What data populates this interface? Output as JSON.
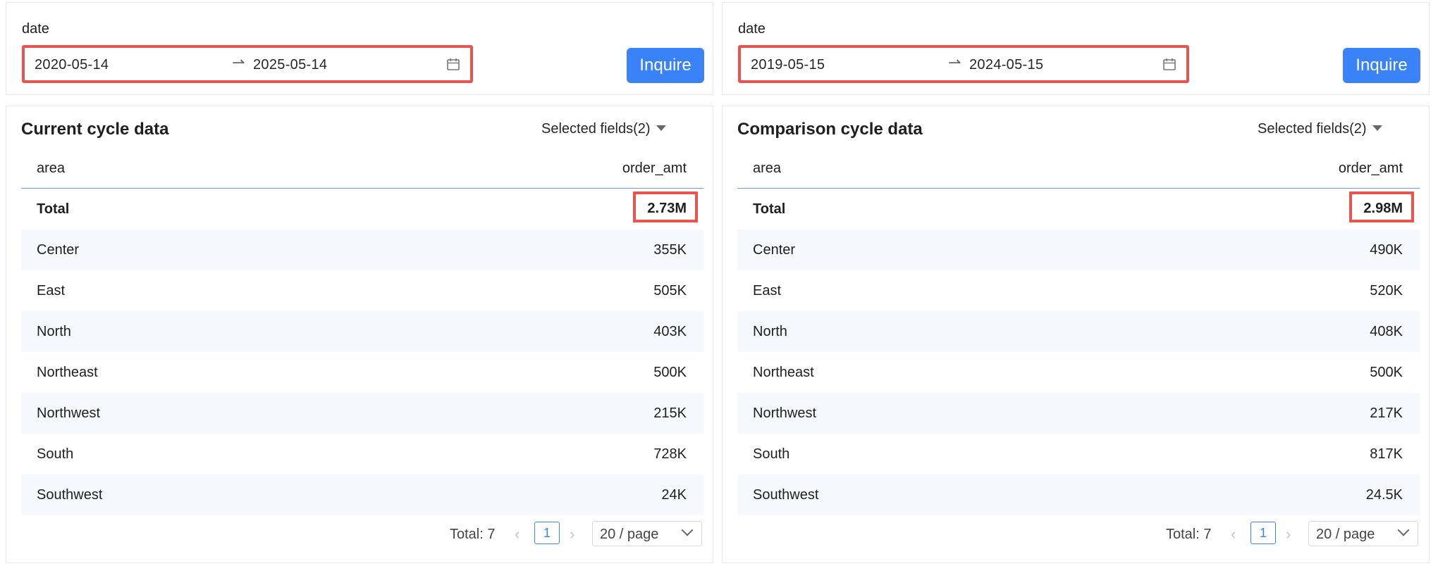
{
  "left": {
    "filter": {
      "label": "date",
      "start": "2020-05-14",
      "end": "2025-05-14",
      "arrow": "⇀"
    },
    "inquire_label": "Inquire",
    "title": "Current cycle data",
    "fields_label": "Selected fields(2)",
    "columns": {
      "area": "area",
      "amt": "order_amt"
    },
    "total": {
      "label": "Total",
      "value": "2.73M"
    },
    "rows": [
      {
        "area": "Center",
        "amt": "355K"
      },
      {
        "area": "East",
        "amt": "505K"
      },
      {
        "area": "North",
        "amt": "403K"
      },
      {
        "area": "Northeast",
        "amt": "500K"
      },
      {
        "area": "Northwest",
        "amt": "215K"
      },
      {
        "area": "South",
        "amt": "728K"
      },
      {
        "area": "Southwest",
        "amt": "24K"
      }
    ],
    "pager": {
      "total": "Total: 7",
      "page": "1",
      "size": "20 / page"
    }
  },
  "right": {
    "filter": {
      "label": "date",
      "start": "2019-05-15",
      "end": "2024-05-15",
      "arrow": "⇀"
    },
    "inquire_label": "Inquire",
    "title": "Comparison cycle data",
    "fields_label": "Selected fields(2)",
    "columns": {
      "area": "area",
      "amt": "order_amt"
    },
    "total": {
      "label": "Total",
      "value": "2.98M"
    },
    "rows": [
      {
        "area": "Center",
        "amt": "490K"
      },
      {
        "area": "East",
        "amt": "520K"
      },
      {
        "area": "North",
        "amt": "408K"
      },
      {
        "area": "Northeast",
        "amt": "500K"
      },
      {
        "area": "Northwest",
        "amt": "217K"
      },
      {
        "area": "South",
        "amt": "817K"
      },
      {
        "area": "Southwest",
        "amt": "24.5K"
      }
    ],
    "pager": {
      "total": "Total: 7",
      "page": "1",
      "size": "20 / page"
    }
  },
  "colors": {
    "accent": "#3a82f7",
    "highlight": "#e8554e",
    "row_alt": "#f5f8fd"
  },
  "icons": {
    "calendar": "calendar-icon",
    "caret": "caret-down-icon",
    "chevron": "chevron-down-icon"
  }
}
